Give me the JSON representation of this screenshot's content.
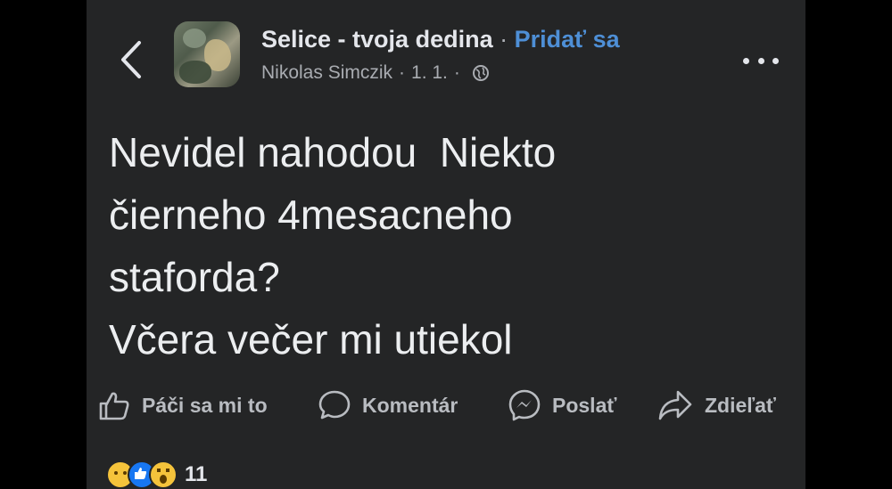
{
  "header": {
    "group_name": "Selice - tvoja dedina",
    "separator": "·",
    "join_label": "Pridať sa",
    "author": "Nikolas Simczik",
    "date": "1. 1.",
    "meta_separator": "·",
    "privacy_icon": "globe-icon",
    "back_icon": "chevron-left-icon",
    "more_icon": "more-dots-icon"
  },
  "post": {
    "lines": [
      "Nevidel nahodou  Niekto",
      "čierneho 4mesacneho",
      "staforda?",
      "Včera večer mi utiekol"
    ]
  },
  "actions": [
    {
      "label": "Páči sa mi to",
      "icon": "thumbs-up-icon"
    },
    {
      "label": "Komentár",
      "icon": "comment-icon"
    },
    {
      "label": "Poslať",
      "icon": "messenger-icon"
    },
    {
      "label": "Zdieľať",
      "icon": "share-icon"
    }
  ],
  "reactions": {
    "icons": [
      "sad-emoji-icon",
      "like-icon",
      "wow-emoji-icon"
    ],
    "count": "11"
  },
  "colors": {
    "background": "#242526",
    "text_primary": "#e4e6eb",
    "text_secondary": "#a9acb1",
    "link_blue": "#4e8fd6",
    "like_blue": "#1877f2",
    "emoji_yellow": "#f5c33b"
  }
}
